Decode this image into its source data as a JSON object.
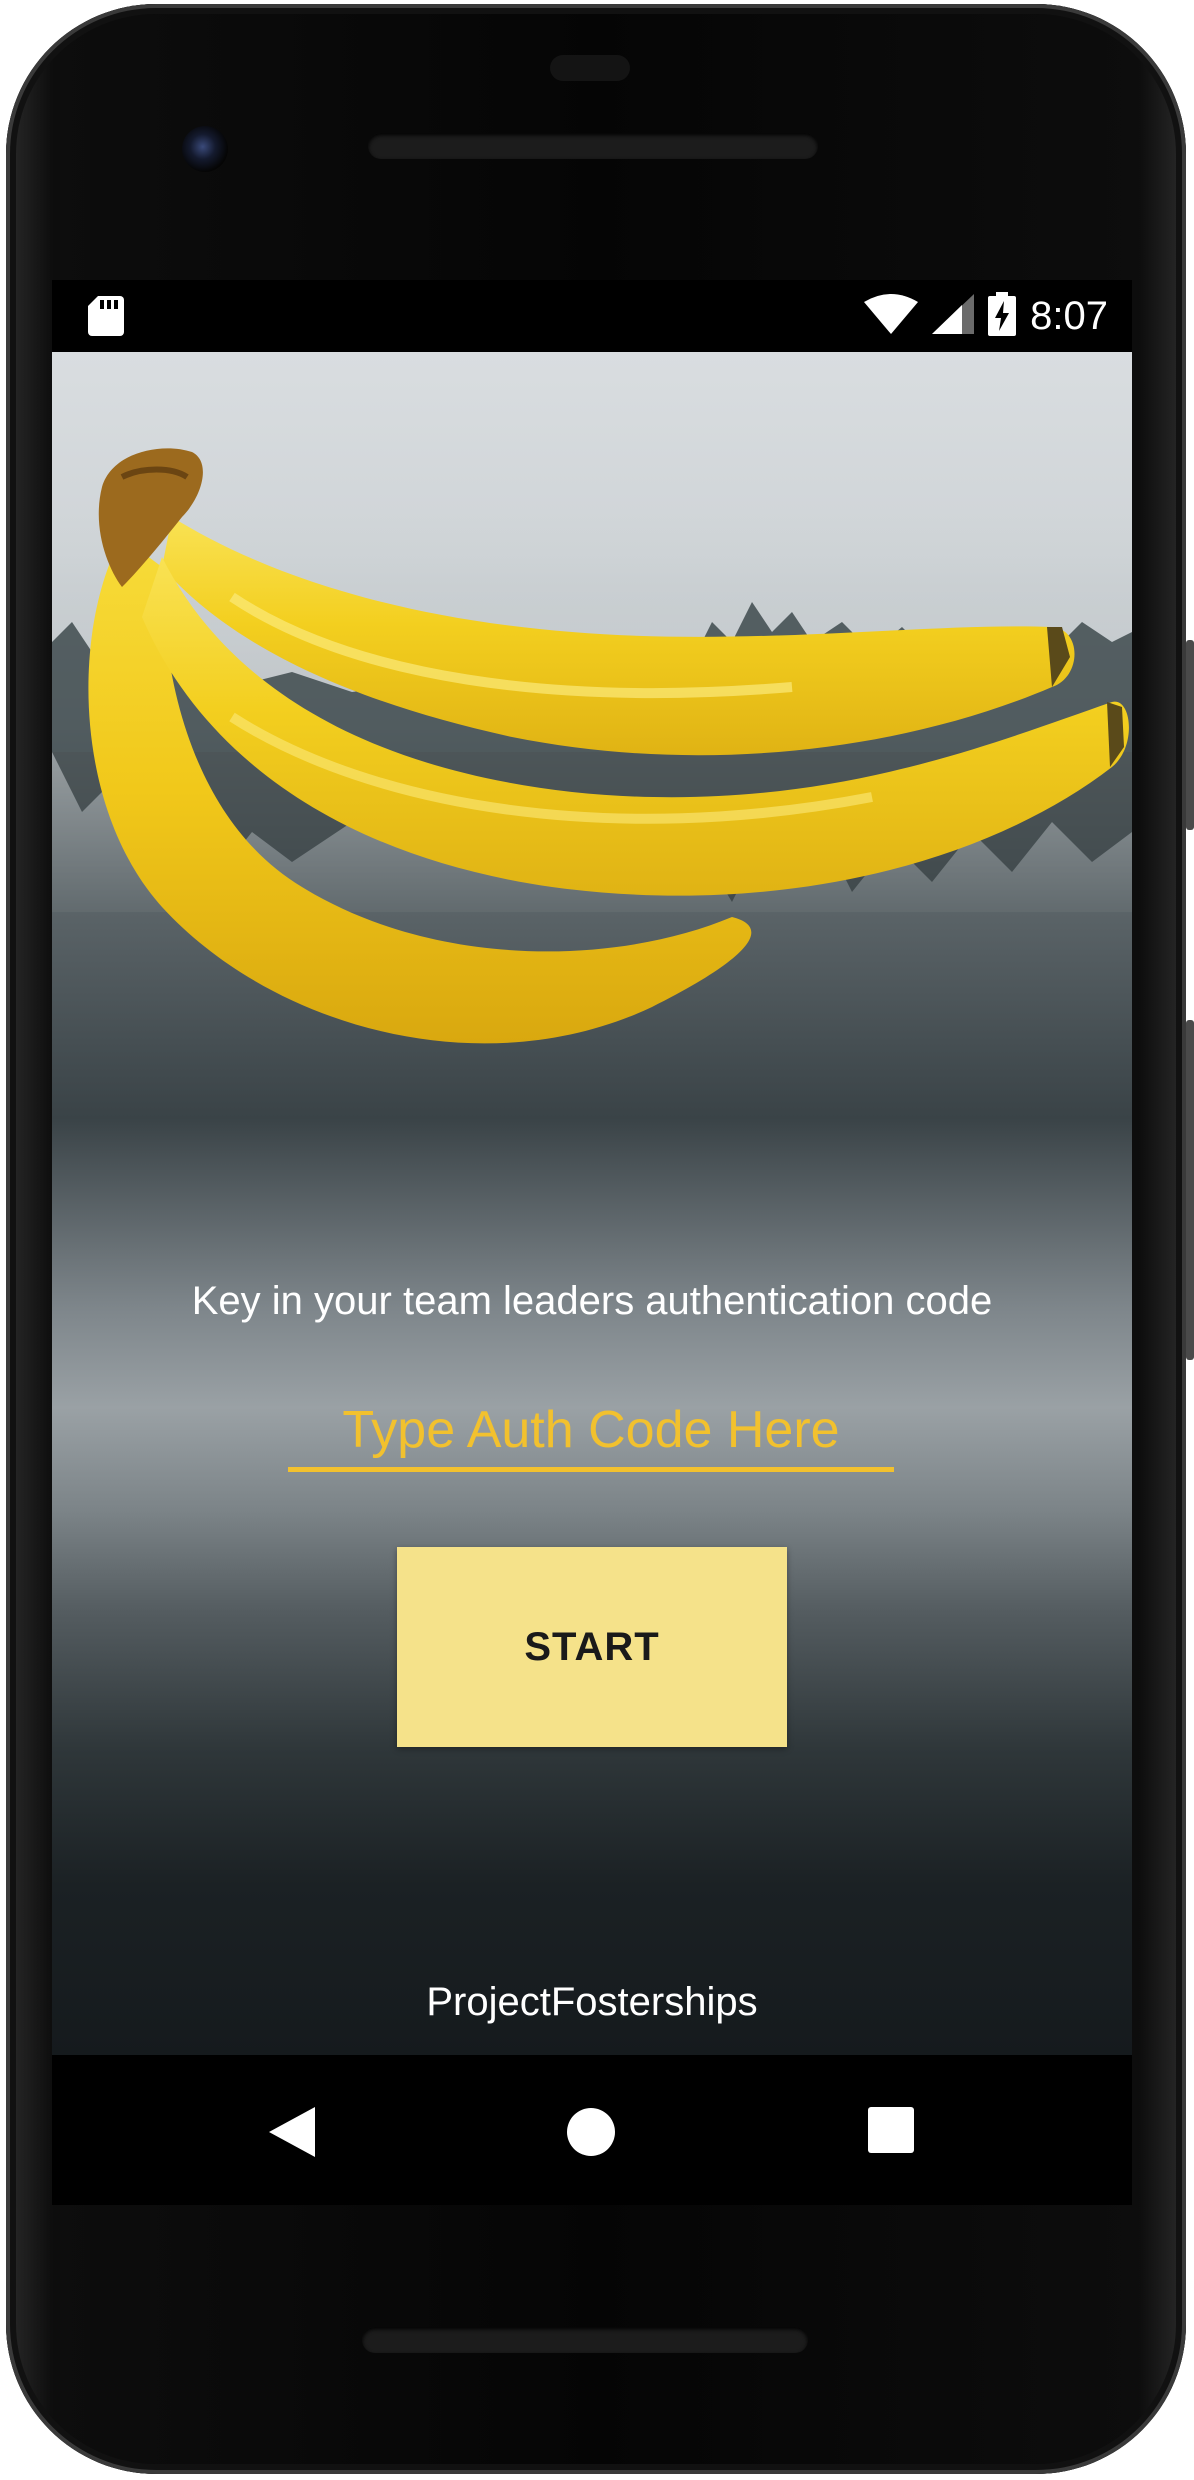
{
  "status_bar": {
    "time": "8:07",
    "icons": [
      "sd-card-icon",
      "wifi-icon",
      "cell-signal-icon",
      "battery-charging-icon"
    ]
  },
  "main": {
    "instruction": "Key in your team leaders authentication code",
    "auth_input": {
      "placeholder": "Type Auth Code Here",
      "value": ""
    },
    "start_button": "START",
    "footer": "ProjectFosterships"
  },
  "nav_bar": {
    "icons": [
      "back-icon",
      "home-icon",
      "recent-apps-icon"
    ]
  },
  "colors": {
    "accent": "#f2c12e",
    "button_background": "#f5e28a",
    "text_light": "#ffffff"
  }
}
